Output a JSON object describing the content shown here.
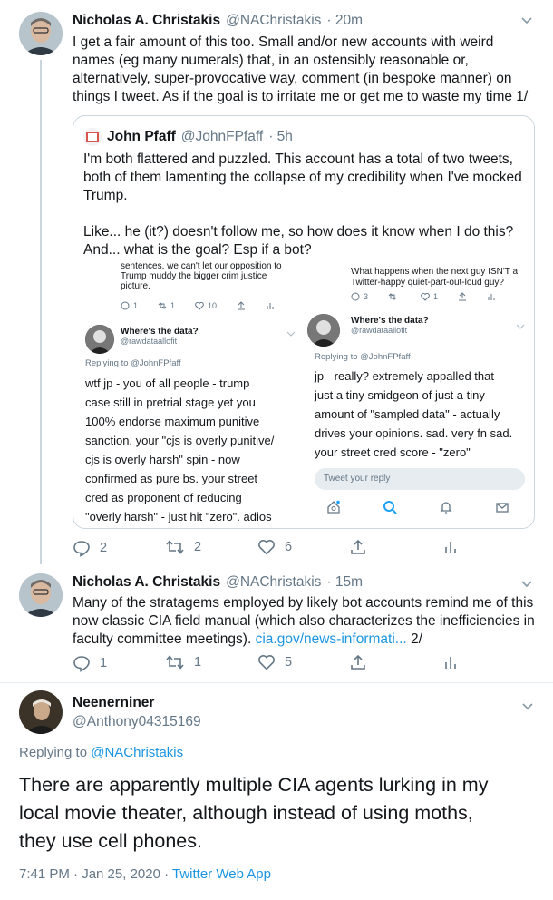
{
  "tweet1": {
    "name": "Nicholas A. Christakis",
    "handle": "@NAChristakis",
    "time": "· 20m",
    "lines": [
      "I get a fair amount of this too. Small and/or new accounts with weird",
      "names (eg many numerals) that, in an ostensibly reasonable or,",
      "alternatively, super-provocative way, comment (in bespoke manner) on",
      "things I tweet. As if the goal is to irritate me or get me to waste my time 1/"
    ],
    "actions": {
      "reply": "2",
      "retweet": "2",
      "like": "6"
    }
  },
  "quote": {
    "name": "John Pfaff",
    "handle": "@JohnFPfaff",
    "time": "· 5h",
    "lines": [
      "I'm both flattered and puzzled. This account has a total of two tweets,",
      "both of them lamenting the collapse of my credibility when I've mocked",
      "Trump.",
      "",
      "Like... he (it?) doesn't follow me, so how does it know when I do this?",
      "And... what is the goal? Esp if a bot?"
    ],
    "left_shot": {
      "top_lines": [
        "sentences, we can't let our opposition to",
        "Trump muddy the bigger crim justice",
        "picture."
      ],
      "stats": {
        "reply": "1",
        "retweet": "1",
        "like": "10"
      },
      "name": "Where's the data?",
      "handle": "@rawdataallofit",
      "replying": "Replying to @JohnFPfaff",
      "body": [
        "wtf jp - you of all people - trump",
        "case still in pretrial stage yet you",
        "100% endorse maximum punitive",
        "sanction. your \"cjs is overly punitive/",
        "cjs is overly harsh\" spin - now",
        "confirmed as pure bs. your street",
        "cred as proponent of reducing",
        "\"overly harsh\" - just hit \"zero\". adios"
      ]
    },
    "right_shot": {
      "top_lines": [
        "What happens when the next guy ISN'T a",
        "Twitter-happy quiet-part-out-loud guy?"
      ],
      "stats": {
        "reply": "3",
        "retweet": "",
        "like": "1"
      },
      "name": "Where's the data?",
      "handle": "@rawdataallofit",
      "replying": "Replying to @JohnFPfaff",
      "body": [
        "jp - really? extremely appalled that",
        "just a tiny smidgeon of just a tiny",
        "amount of \"sampled data\" - actually",
        "drives your opinions. sad. very fn sad.",
        "your street cred score - \"zero\""
      ],
      "reply_placeholder": "Tweet your reply"
    }
  },
  "tweet2": {
    "name": "Nicholas A. Christakis",
    "handle": "@NAChristakis",
    "time": "· 15m",
    "lines": [
      "Many of the stratagems employed by likely bot accounts remind me of this",
      "now classic CIA field manual (which also characterizes the inefficiencies in"
    ],
    "line3_pre": "faculty committee meetings). ",
    "link": "cia.gov/news-informati...",
    "line3_post": " 2/",
    "actions": {
      "reply": "1",
      "retweet": "1",
      "like": "5"
    }
  },
  "main_tweet": {
    "name": "Neenerniner",
    "handle": "@Anthony04315169",
    "replying_prefix": "Replying to ",
    "replying_handle": "@NAChristakis",
    "lines": [
      "There are apparently multiple CIA agents lurking in my",
      "local movie theater, although instead of using moths,",
      "they use cell phones."
    ],
    "timestamp": "7:41 PM · Jan 25, 2020 · ",
    "source": "Twitter Web App"
  },
  "colors": {
    "accent": "#1b95e0",
    "muted": "#657786",
    "border": "#ccd6dd"
  }
}
